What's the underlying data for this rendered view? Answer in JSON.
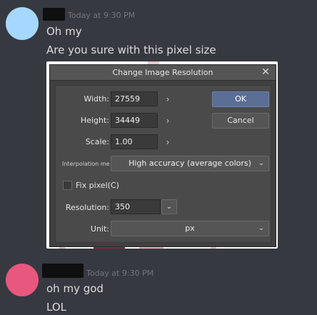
{
  "messages": [
    {
      "avatar_color": "#a6d8ff",
      "timestamp": "Today at 9:30 PM",
      "lines": [
        "Oh my",
        "Are you sure with this pixel size"
      ]
    },
    {
      "avatar_color": "#e8577d",
      "timestamp": "Today at 9:30 PM",
      "lines": [
        "oh my god",
        "LOL"
      ]
    }
  ],
  "dialog": {
    "title": "Change Image Resolution",
    "close_glyph": "✕",
    "width_label": "Width:",
    "width_value": "27559",
    "height_label": "Height:",
    "height_value": "34449",
    "scale_label": "Scale:",
    "scale_value": "1.00",
    "arrow_glyph": "›",
    "ok_label": "OK",
    "cancel_label": "Cancel",
    "interpolation_label": "Interpolation meth",
    "interpolation_value": "High accuracy (average colors)",
    "fix_pixel_label": "Fix pixel(C)",
    "resolution_label": "Resolution:",
    "resolution_value": "350",
    "unit_label": "Unit:",
    "unit_value": "px",
    "caret_glyph": "⌄"
  }
}
